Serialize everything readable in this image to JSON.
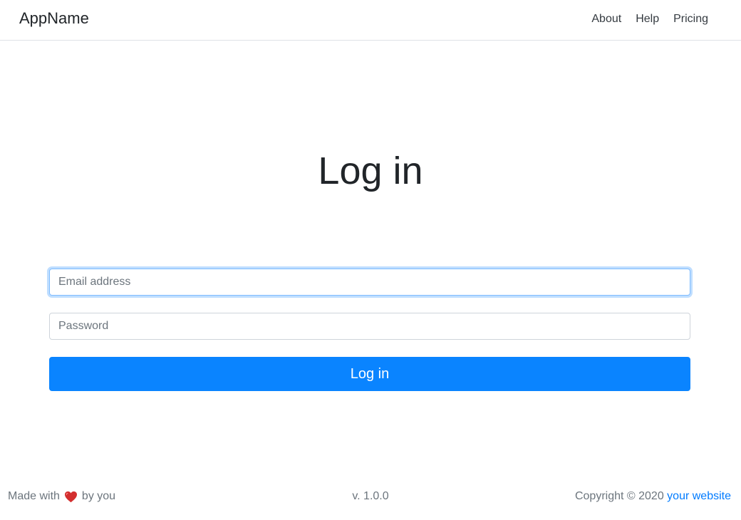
{
  "navbar": {
    "brand": "AppName",
    "links": [
      "About",
      "Help",
      "Pricing"
    ]
  },
  "main": {
    "title": "Log in",
    "email_placeholder": "Email address",
    "password_placeholder": "Password",
    "submit_label": "Log in"
  },
  "footer": {
    "made_with": "Made with",
    "heart_icon": "heart-icon",
    "by_you": "by you",
    "version": "v. 1.0.0",
    "copyright": "Copyright © 2020",
    "website_link": "your website"
  },
  "colors": {
    "primary": "#0a84ff",
    "heart": "#d32f2f",
    "link": "#007bff"
  }
}
